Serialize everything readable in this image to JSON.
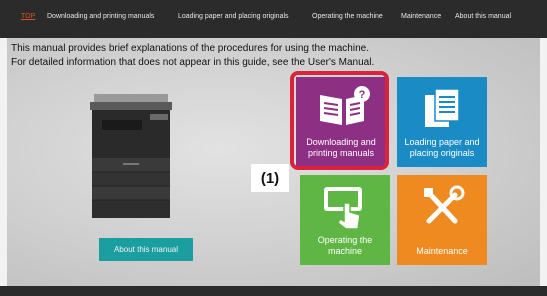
{
  "nav": {
    "items": [
      {
        "label": "TOP",
        "active": true
      },
      {
        "label": "Downloading and printing manuals"
      },
      {
        "label": "Loading paper and placing originals"
      },
      {
        "label": "Operating the machine"
      },
      {
        "label": "Maintenance"
      },
      {
        "label": "About this manual"
      }
    ]
  },
  "intro": {
    "line1": "This manual provides brief explanations of the procedures for using the machine.",
    "line2": "For detailed information that does not appear in this guide, see the User's Manual."
  },
  "about_button": {
    "label": "About this manual"
  },
  "tiles": {
    "downloading": {
      "label": "Downloading and printing manuals",
      "color": "#8d2f83",
      "icon": "book-question-icon"
    },
    "loading": {
      "label": "Loading paper and placing originals",
      "color": "#1b8bc6",
      "icon": "documents-icon"
    },
    "operating": {
      "label": "Operating the machine",
      "color": "#5fb644",
      "icon": "touch-panel-icon"
    },
    "maintenance": {
      "label": "Maintenance",
      "color": "#ef8a20",
      "icon": "tools-icon"
    }
  },
  "callout": {
    "label": "(1)",
    "color": "#d8233b"
  }
}
